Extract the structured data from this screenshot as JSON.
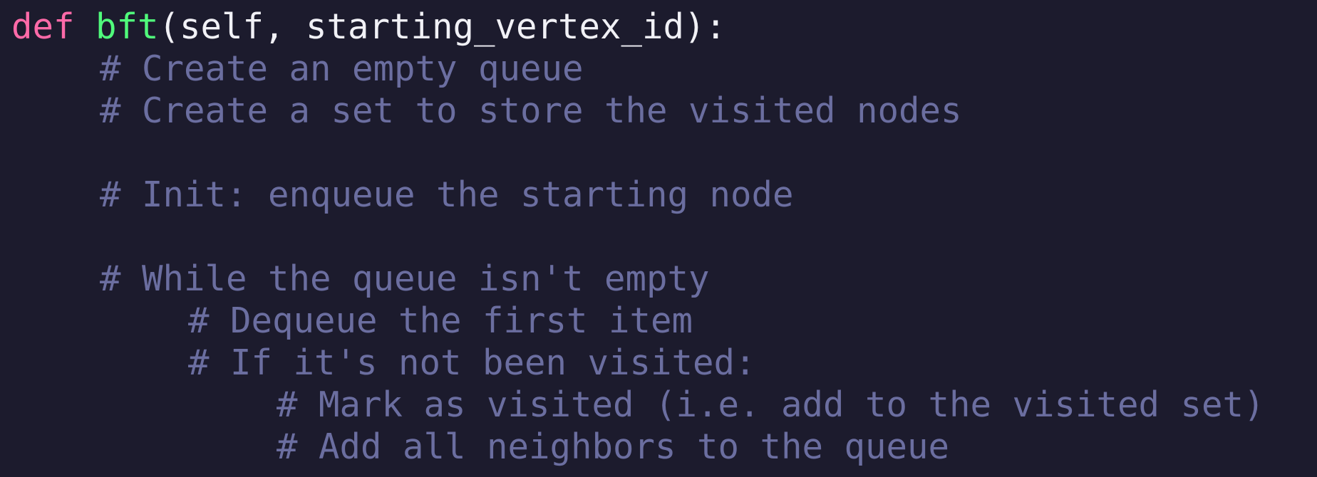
{
  "code": {
    "def_line": {
      "keyword": "def",
      "function_name": "bft",
      "signature": "(self, starting_vertex_id):"
    },
    "comments": {
      "line_1": "# Create an empty queue",
      "line_2": "# Create a set to store the visited nodes",
      "line_3": "# Init: enqueue the starting node",
      "line_4": "# While the queue isn't empty",
      "line_5": "# Dequeue the first item",
      "line_6": "# If it's not been visited:",
      "line_7": "# Mark as visited (i.e. add to the visited set)",
      "line_8": "# Add all neighbors to the queue"
    }
  },
  "colors": {
    "background": "#1c1b2d",
    "keyword": "#ff6aa8",
    "function_name": "#50fa7b",
    "plain_text": "#f1f1f6",
    "comment": "#6b6ea0"
  }
}
